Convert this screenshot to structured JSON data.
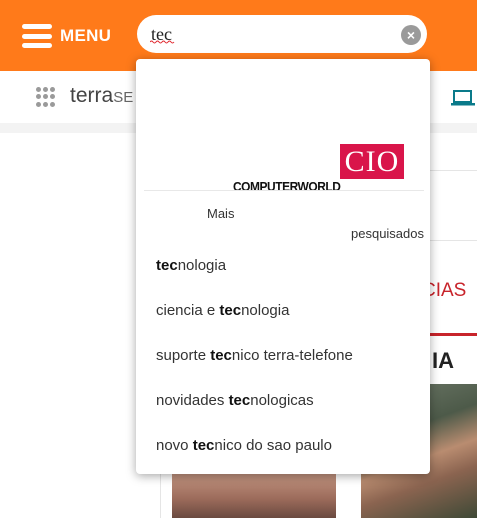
{
  "header": {
    "menu_label": "MENU",
    "search_value": "tec",
    "clear_icon": "close-icon"
  },
  "subbar": {
    "brand_main": "terra",
    "brand_suffix": "SE",
    "apps_icon": "apps-grid-icon",
    "device_icon": "laptop-icon"
  },
  "background": {
    "section_label": "CIAS",
    "headline_fragment": "IA"
  },
  "dropdown": {
    "ad_logos": [
      "CIO",
      "COMPUTERWORLD"
    ],
    "mais": "Mais",
    "pesquisados": "pesquisados",
    "suggestions": [
      {
        "pre": "",
        "bold": "tec",
        "post": "nologia"
      },
      {
        "pre": "ciencia e ",
        "bold": "tec",
        "post": "nologia"
      },
      {
        "pre": "suporte ",
        "bold": "tec",
        "post": "nico terra-telefone"
      },
      {
        "pre": "novidades ",
        "bold": "tec",
        "post": "nologicas"
      },
      {
        "pre": "novo ",
        "bold": "tec",
        "post": "nico do sao paulo"
      }
    ]
  },
  "colors": {
    "brand_orange": "#ff7a1a",
    "accent_red": "#c8242b",
    "cio_pink": "#d9154a"
  }
}
